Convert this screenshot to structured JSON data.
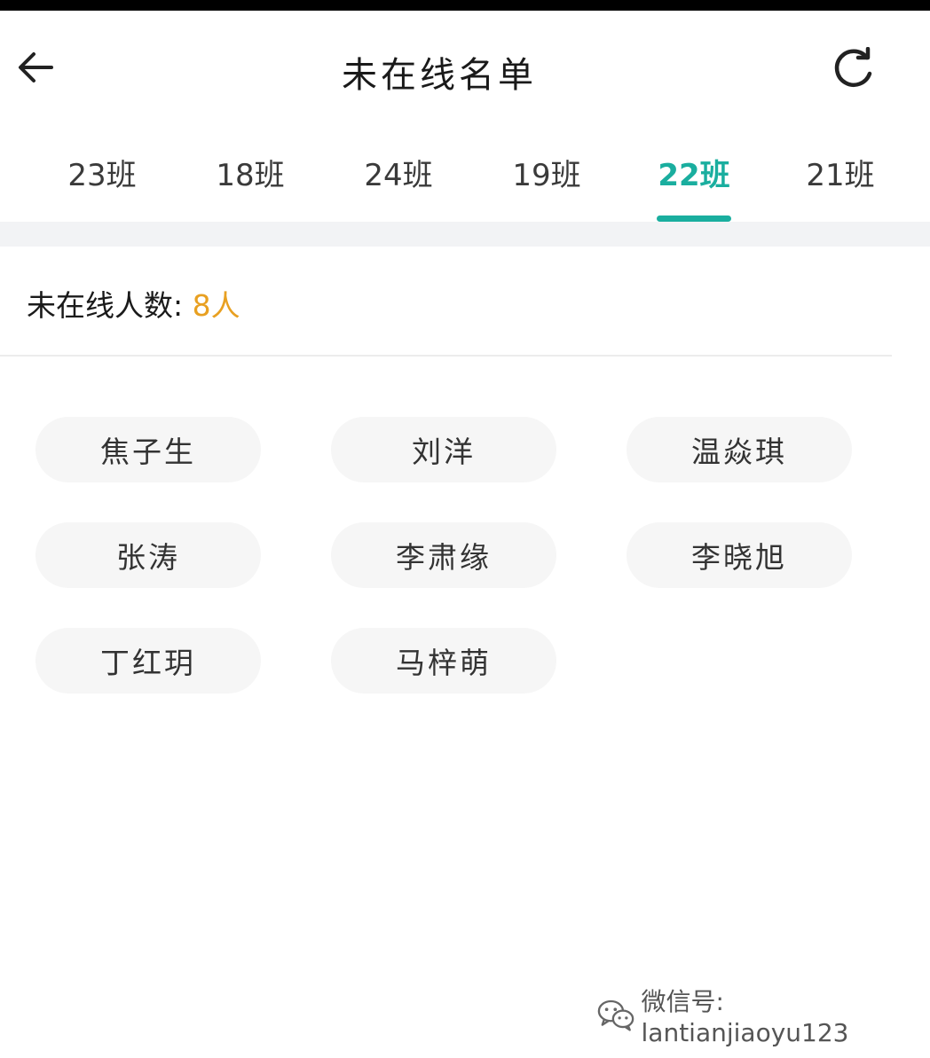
{
  "header": {
    "title": "未在线名单"
  },
  "tabs": [
    {
      "label": "23班",
      "active": false
    },
    {
      "label": "18班",
      "active": false
    },
    {
      "label": "24班",
      "active": false
    },
    {
      "label": "19班",
      "active": false
    },
    {
      "label": "22班",
      "active": true
    },
    {
      "label": "21班",
      "active": false
    }
  ],
  "summary": {
    "label": "未在线人数:",
    "count": "8人"
  },
  "students": [
    {
      "name": "焦子生"
    },
    {
      "name": "刘洋"
    },
    {
      "name": "温焱琪"
    },
    {
      "name": "张涛"
    },
    {
      "name": "李肃缘"
    },
    {
      "name": "李晓旭"
    },
    {
      "name": "丁红玥"
    },
    {
      "name": "马梓萌"
    }
  ],
  "watermark": {
    "text": "微信号: lantianjiaoyu123"
  },
  "colors": {
    "accent": "#1aae9f",
    "count_highlight": "#e8a021",
    "chip_background": "#f6f6f6"
  }
}
